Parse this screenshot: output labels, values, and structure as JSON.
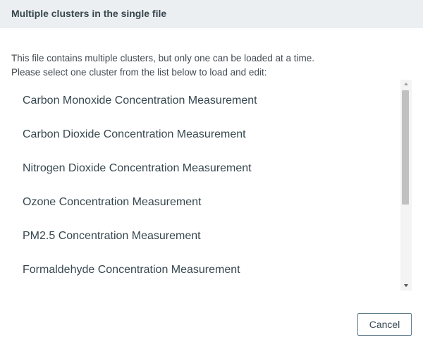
{
  "dialog": {
    "title": "Multiple clusters in the single file",
    "message_line1": "This file contains multiple clusters, but only one can be loaded at a time.",
    "message_line2": "Please select one cluster from the list below to load and edit:"
  },
  "clusters": [
    "Carbon Monoxide Concentration Measurement",
    "Carbon Dioxide Concentration Measurement",
    "Nitrogen Dioxide Concentration Measurement",
    "Ozone Concentration Measurement",
    "PM2.5 Concentration Measurement",
    "Formaldehyde Concentration Measurement"
  ],
  "buttons": {
    "cancel_label": "Cancel"
  },
  "icons": {
    "scroll_up": "chevron-up-icon",
    "scroll_down": "chevron-down-icon"
  },
  "colors": {
    "header_bg": "#eceff1",
    "text": "#37474f",
    "button_border": "#607d8b"
  }
}
